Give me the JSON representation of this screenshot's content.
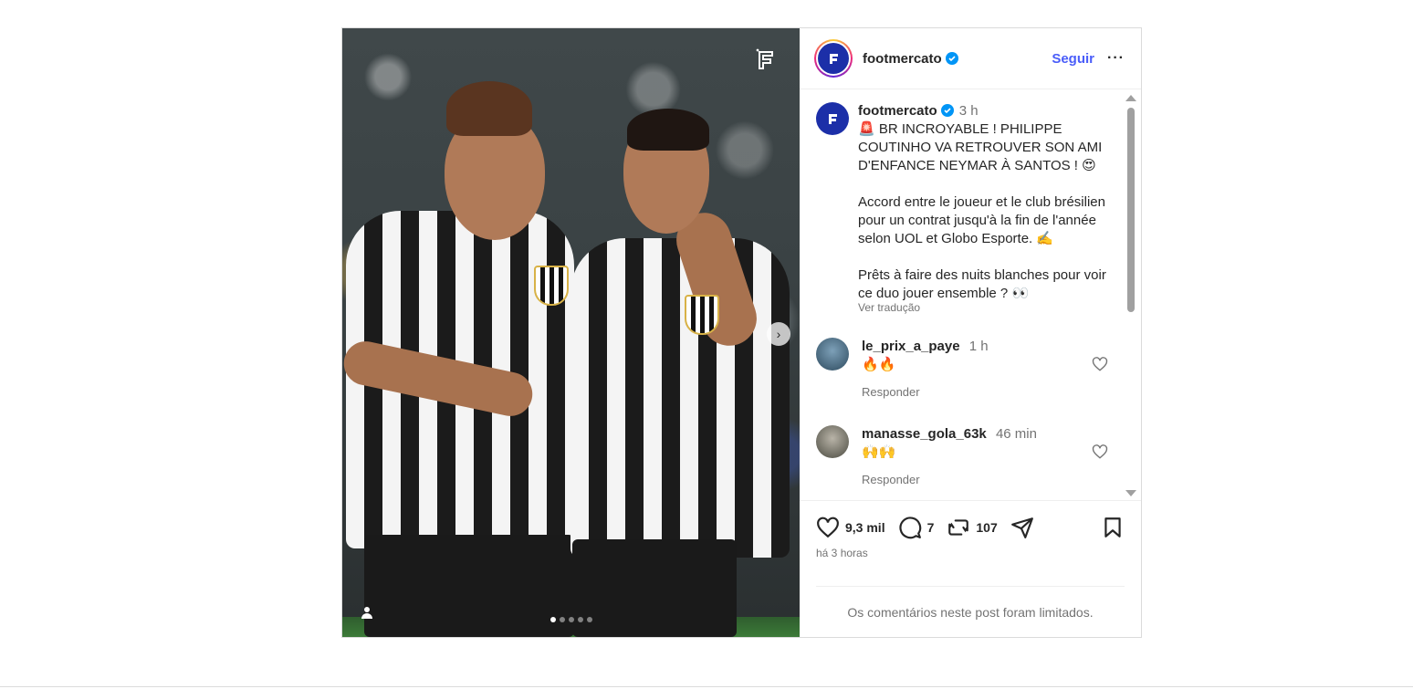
{
  "post": {
    "username": "footmercato",
    "follow_label": "Seguir",
    "more_label": "···",
    "caption": {
      "time": "3 h",
      "line1": "🚨 BR INCROYABLE ! PHILIPPE COUTINHO VA RETROUVER SON AMI D'ENFANCE NEYMAR À SANTOS ! 😍",
      "line2": "Accord entre le joueur et le club brésilien pour un contrat jusqu'à la fin de l'année selon UOL et Globo Esporte. ✍️",
      "line3": "Prêts à faire des nuits blanches pour voir ce duo jouer ensemble ? 👀",
      "translate_label": "Ver tradução"
    },
    "comments": [
      {
        "user": "le_prix_a_paye",
        "time": "1 h",
        "text": "🔥🔥",
        "reply_label": "Responder"
      },
      {
        "user": "manasse_gola_63k",
        "time": "46 min",
        "text": "🙌🙌",
        "reply_label": "Responder"
      }
    ],
    "likes": "9,3 mil",
    "comments_count": "7",
    "reposts": "107",
    "posted_ago": "há 3 horas",
    "limited_notice": "Os comentários neste post foram limitados.",
    "carousel": {
      "current": 1,
      "total": 5
    }
  },
  "colors": {
    "accent": "#4a5df9",
    "verified": "#0095f6",
    "brand": "#1c2fa8"
  }
}
